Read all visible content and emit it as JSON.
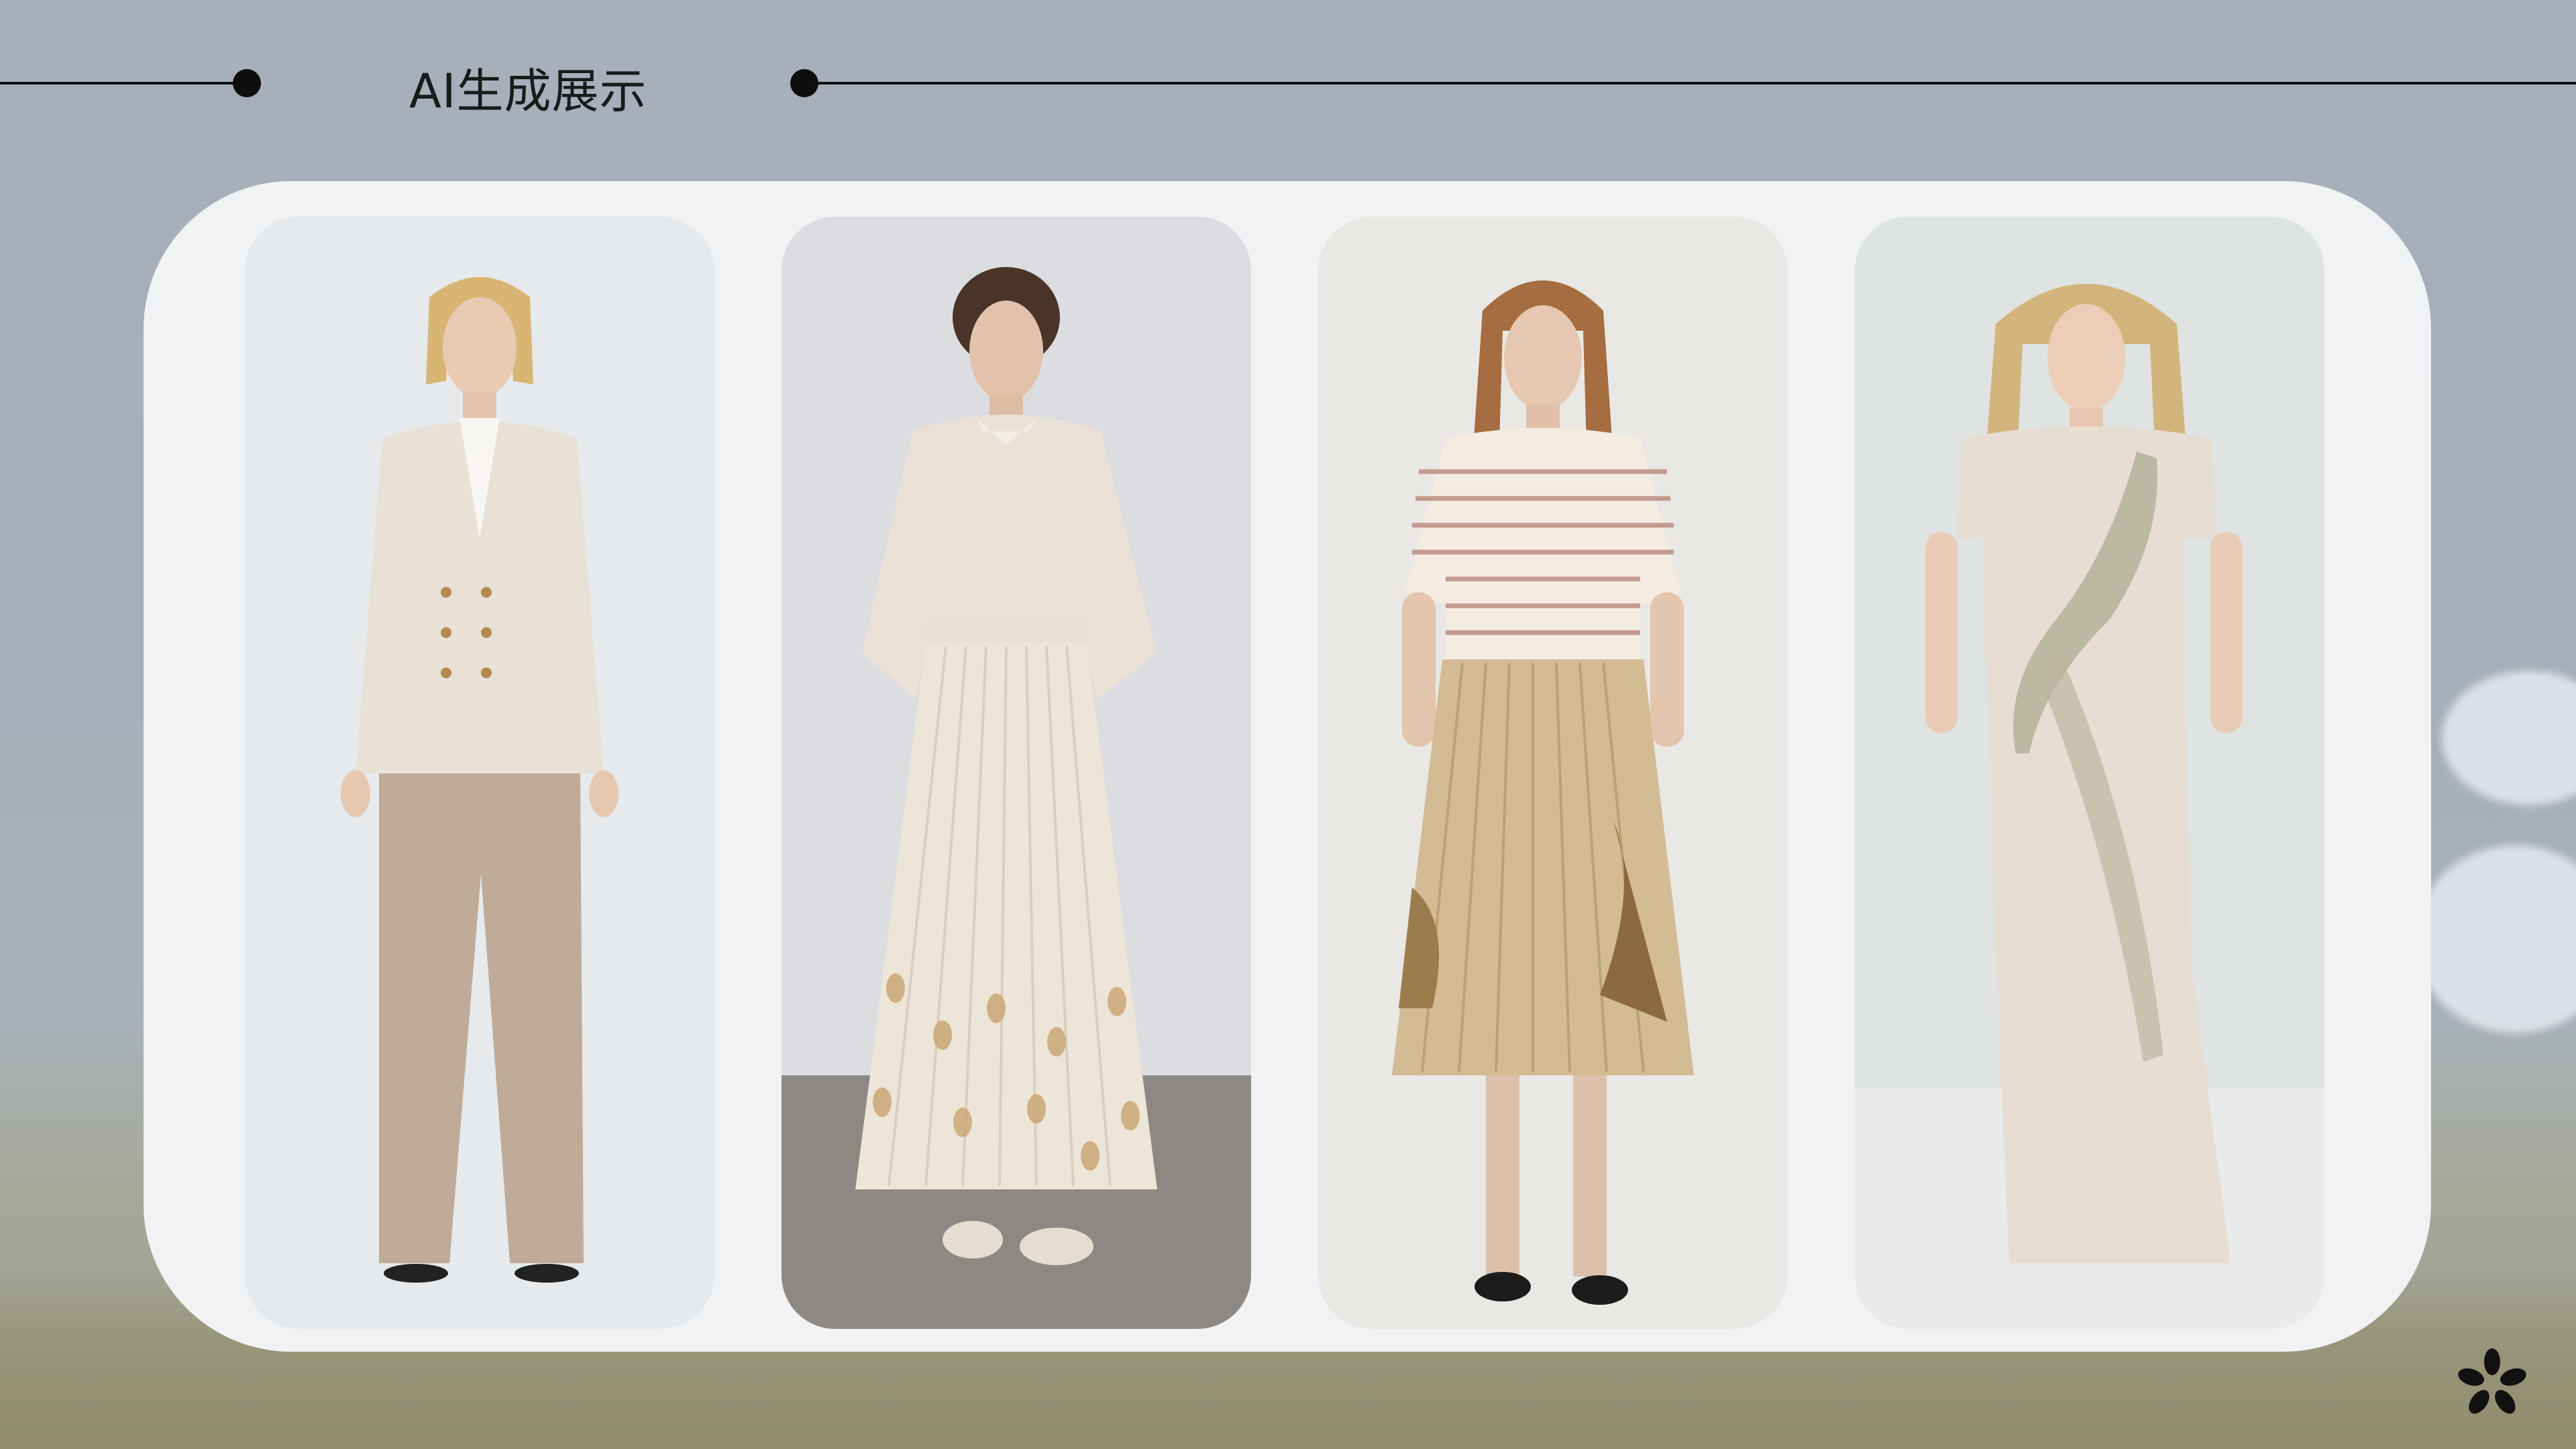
{
  "slide": {
    "title": "AI生成展示"
  },
  "gallery": {
    "images": [
      {
        "icon": "model-beige-suit-image"
      },
      {
        "icon": "model-pleated-skirt-blouse-image"
      },
      {
        "icon": "model-striped-cardigan-image"
      },
      {
        "icon": "model-draped-dress-image"
      }
    ]
  },
  "colors": {
    "background": "#a8afba",
    "panel": "#f1f2f3",
    "line": "#111111"
  },
  "logo": {
    "icon": "asterisk-logo-icon"
  }
}
